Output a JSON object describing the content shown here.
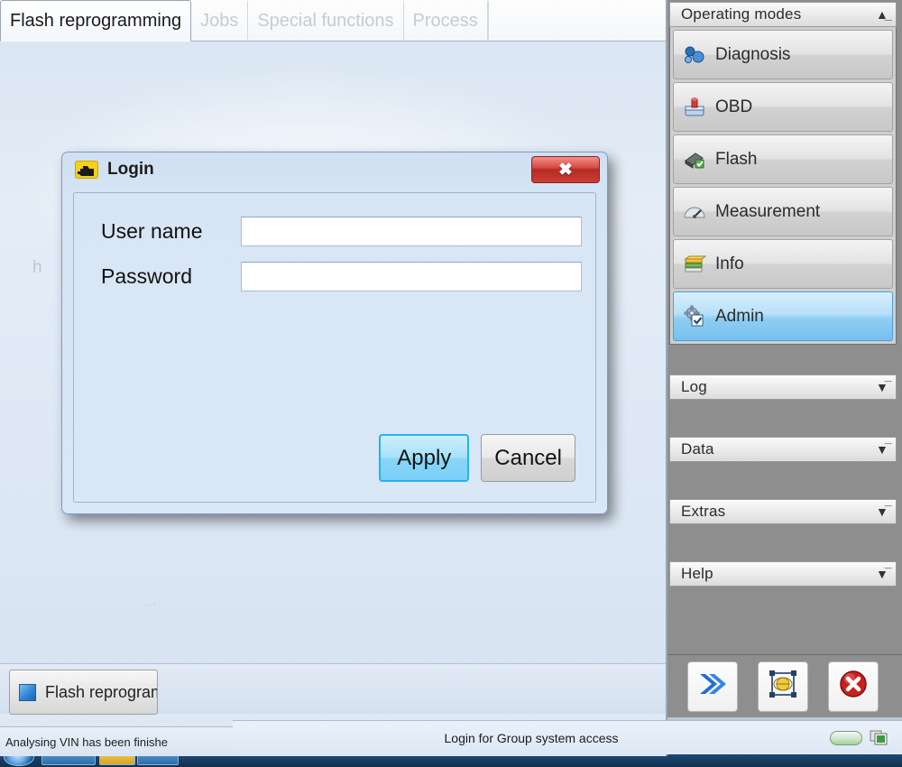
{
  "app": {
    "tabs": [
      {
        "label": "Flash reprogramming",
        "active": true
      },
      {
        "label": "Jobs",
        "active": false
      },
      {
        "label": "Special functions",
        "active": false
      },
      {
        "label": "Process",
        "active": false
      }
    ],
    "ghost_text_left": "h",
    "ghost_text_center": "...",
    "window_button": "Flash reprogram",
    "window_button_icon": "blue-square-icon",
    "status_left": "Analysing VIN has been finishe"
  },
  "dialog": {
    "title": "Login",
    "title_icon": "engine-check-icon",
    "close_label": "x",
    "fields": [
      {
        "label": "User name",
        "value": "",
        "placeholder": ""
      },
      {
        "label": "Password",
        "value": "",
        "placeholder": ""
      }
    ],
    "apply_label": "Apply",
    "cancel_label": "Cancel"
  },
  "sidebar": {
    "operating_modes": {
      "header": "Operating modes",
      "collapse_icon": "chevron-up-icon",
      "items": [
        {
          "label": "Diagnosis",
          "icon": "diagnosis-icon",
          "selected": false
        },
        {
          "label": "OBD",
          "icon": "obd-icon",
          "selected": false
        },
        {
          "label": "Flash",
          "icon": "flash-icon",
          "selected": false
        },
        {
          "label": "Measurement",
          "icon": "measurement-icon",
          "selected": false
        },
        {
          "label": "Info",
          "icon": "info-icon",
          "selected": false
        },
        {
          "label": "Admin",
          "icon": "admin-icon",
          "selected": true
        }
      ]
    },
    "sections": [
      {
        "label": "Log",
        "expand_icon": "chevron-down-icon"
      },
      {
        "label": "Data",
        "expand_icon": "chevron-down-icon"
      },
      {
        "label": "Extras",
        "expand_icon": "chevron-down-icon"
      },
      {
        "label": "Help",
        "expand_icon": "chevron-down-icon"
      }
    ],
    "toolbar": [
      {
        "name": "forward-button",
        "icon": "double-chevron-right-icon"
      },
      {
        "name": "vehicle-identification-button",
        "icon": "framed-globe-icon"
      },
      {
        "name": "stop-button",
        "icon": "red-x-circle-icon"
      }
    ]
  },
  "global_status": {
    "message": "Login for Group system access",
    "progress_icon": "green-progress-icon",
    "windows_icon": "cards-icon"
  },
  "colors": {
    "accent_blue": "#22b4ef",
    "selected_blue": "#77c0ee",
    "close_red": "#c93f36",
    "sidebar_gray": "#8e8e8e",
    "dialog_blue": "#d8e6f5"
  }
}
